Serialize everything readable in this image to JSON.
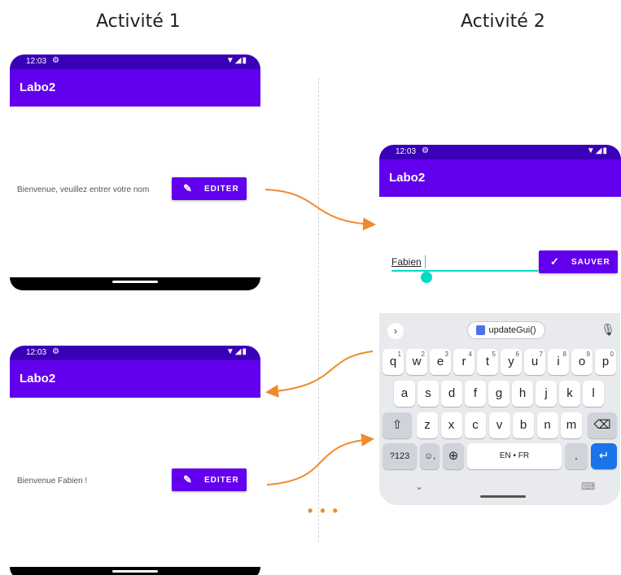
{
  "headings": {
    "activity1": "Activité 1",
    "activity2": "Activité 2"
  },
  "status": {
    "time": "12:03",
    "gear": "⚙",
    "sys": "▼◢▮"
  },
  "app": {
    "title": "Labo2"
  },
  "screen1": {
    "message": "Bienvenue, veuillez entrer votre nom",
    "button_icon": "✎",
    "button_label": "EDITER"
  },
  "screen2": {
    "input_value": "Fabien",
    "button_icon": "✓",
    "button_label": "SAUVER"
  },
  "screen3": {
    "message": "Bienvenue Fabien !",
    "button_icon": "✎",
    "button_label": "EDITER"
  },
  "keyboard": {
    "expand": "›",
    "suggestion": "updateGui()",
    "mic": "🎙",
    "row1": [
      {
        "k": "q",
        "s": "1"
      },
      {
        "k": "w",
        "s": "2"
      },
      {
        "k": "e",
        "s": "3"
      },
      {
        "k": "r",
        "s": "4"
      },
      {
        "k": "t",
        "s": "5"
      },
      {
        "k": "y",
        "s": "6"
      },
      {
        "k": "u",
        "s": "7"
      },
      {
        "k": "i",
        "s": "8"
      },
      {
        "k": "o",
        "s": "9"
      },
      {
        "k": "p",
        "s": "0"
      }
    ],
    "row2": [
      "a",
      "s",
      "d",
      "f",
      "g",
      "h",
      "j",
      "k",
      "l"
    ],
    "row3": [
      "z",
      "x",
      "c",
      "v",
      "b",
      "n",
      "m"
    ],
    "shift": "⇧",
    "backspace": "⌫",
    "numbers": "?123",
    "emoji": "☺,",
    "globe": "⊕",
    "space": "EN • FR",
    "period": ".",
    "enter": "↵",
    "hide": "⌄",
    "kbswitch": "⌨"
  },
  "separator": "• • •",
  "colors": {
    "primary": "#6200ee",
    "status": "#3a00b8",
    "accent": "#03dac5",
    "arrow": "#f08a2c"
  }
}
